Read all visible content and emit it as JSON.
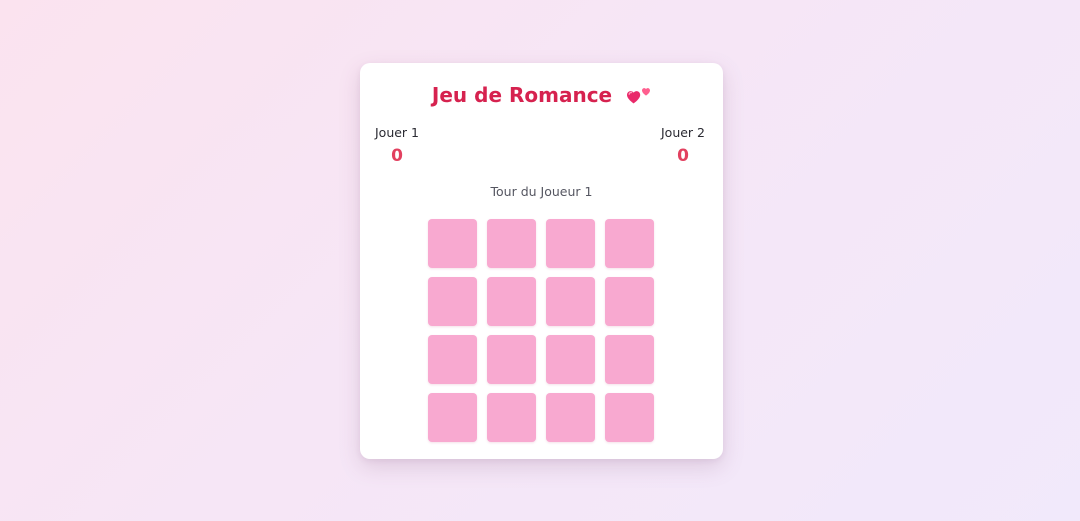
{
  "game": {
    "title": "Jeu de Romance",
    "title_icon": "two-hearts-icon",
    "turn_text": "Tour du Joueur 1"
  },
  "players": [
    {
      "name": "Jouer 1",
      "score": "0"
    },
    {
      "name": "Jouer 2",
      "score": "0"
    }
  ],
  "board": {
    "rows": 4,
    "columns": 4,
    "tile_state": "face-down"
  },
  "colors": {
    "accent": "#d6224f",
    "score": "#e2405f",
    "tile": "#f8a9d0",
    "background": "#f6e6f6"
  }
}
